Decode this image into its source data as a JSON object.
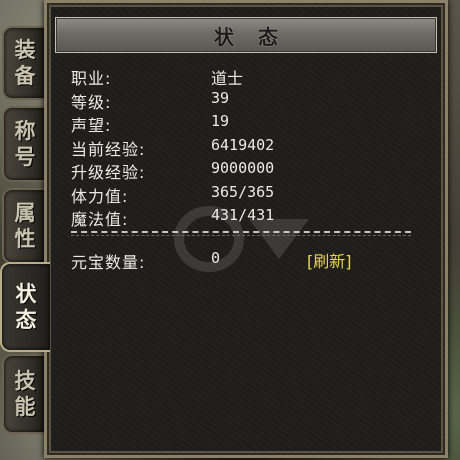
{
  "tabs": [
    {
      "id": "equipment",
      "label": [
        "装",
        "备"
      ],
      "active": false
    },
    {
      "id": "title",
      "label": [
        "称",
        "号"
      ],
      "active": false
    },
    {
      "id": "attributes",
      "label": [
        "属",
        "性"
      ],
      "active": false
    },
    {
      "id": "status",
      "label": [
        "状",
        "态"
      ],
      "active": true
    },
    {
      "id": "skills",
      "label": [
        "技",
        "能"
      ],
      "active": false
    }
  ],
  "window": {
    "title": "状态"
  },
  "stats": [
    {
      "label": "职业:",
      "value": "道士"
    },
    {
      "label": "等级:",
      "value": "39"
    },
    {
      "label": "声望:",
      "value": "19"
    },
    {
      "label": "当前经验:",
      "value": "6419402"
    },
    {
      "label": "升级经验:",
      "value": "9000000"
    },
    {
      "label": "体力值:",
      "value": "365/365"
    },
    {
      "label": "魔法值:",
      "value": "431/431"
    }
  ],
  "ingot": {
    "label": "元宝数量:",
    "value": "0",
    "refresh_label": "[刷新]"
  },
  "colors": {
    "refresh": "#e7d84a",
    "text": "#ecece4",
    "frame": "#8c8068"
  }
}
